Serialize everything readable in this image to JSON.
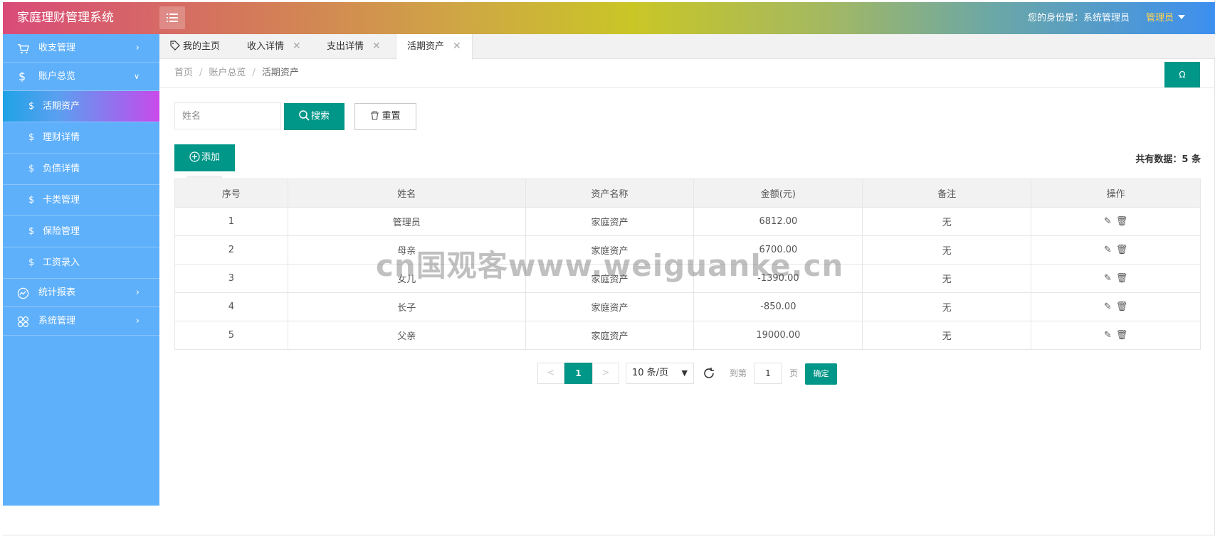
{
  "app": {
    "title": "家庭理财管理系统",
    "identity_label": "您的身份是：系统管理员",
    "user_name": "管理员"
  },
  "sidebar": {
    "items": [
      {
        "label": "收支管理",
        "icon": "cart-icon",
        "arrow": ">"
      },
      {
        "label": "账户总览",
        "icon": "dollar-icon",
        "arrow": "v"
      },
      {
        "label": "活期资产",
        "icon": "dollar-icon",
        "active": true
      },
      {
        "label": "理财详情",
        "icon": "dollar-icon"
      },
      {
        "label": "负债详情",
        "icon": "dollar-icon"
      },
      {
        "label": "卡类管理",
        "icon": "dollar-icon"
      },
      {
        "label": "保险管理",
        "icon": "dollar-icon"
      },
      {
        "label": "工资录入",
        "icon": "dollar-icon"
      },
      {
        "label": "统计报表",
        "icon": "chart-icon",
        "arrow": ">"
      },
      {
        "label": "系统管理",
        "icon": "grid-icon",
        "arrow": ">"
      }
    ]
  },
  "tabs": [
    {
      "label": "我的主页",
      "closable": false
    },
    {
      "label": "收入详情",
      "closable": true
    },
    {
      "label": "支出详情",
      "closable": true
    },
    {
      "label": "活期资产",
      "closable": true,
      "active": true
    }
  ],
  "breadcrumb": [
    "首页",
    "账户总览",
    "活期资产"
  ],
  "refresh_glyph": "Ω",
  "search": {
    "placeholder": "姓名",
    "search_label": "搜索",
    "reset_label": "重置"
  },
  "toolbar": {
    "add_label": "添加",
    "total_label": "共有数据：5 条"
  },
  "table": {
    "headers": [
      "序号",
      "姓名",
      "资产名称",
      "金额(元)",
      "备注",
      "操作"
    ],
    "rows": [
      [
        "1",
        "管理员",
        "家庭资产",
        "6812.00",
        "无"
      ],
      [
        "2",
        "母亲",
        "家庭资产",
        "6700.00",
        "无"
      ],
      [
        "3",
        "女儿",
        "家庭资产",
        "-1390.00",
        "无"
      ],
      [
        "4",
        "长子",
        "家庭资产",
        "-850.00",
        "无"
      ],
      [
        "5",
        "父亲",
        "家庭资产",
        "19000.00",
        "无"
      ]
    ]
  },
  "pager": {
    "prev": "<",
    "current": "1",
    "next": ">",
    "page_size": "10 条/页",
    "goto_label": "到第",
    "goto_value": "1",
    "page_label": "页",
    "ok_label": "确定"
  },
  "watermark": "cn国观客www.weiguanke.cn",
  "colors": {
    "accent": "#009688",
    "sidebar": "#5fb0fb",
    "user_name": "#ffd54d"
  }
}
